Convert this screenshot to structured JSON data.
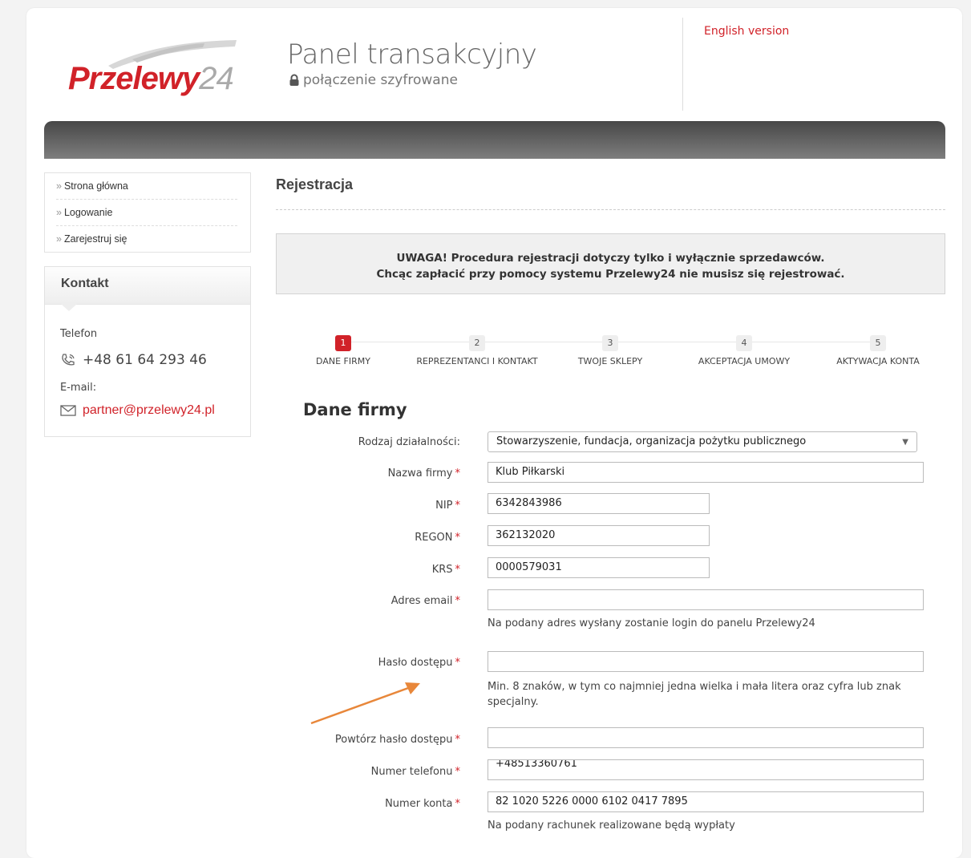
{
  "header": {
    "logo_main": "Przelewy",
    "logo_num": "24",
    "title": "Panel transakcyjny",
    "subtitle": "połączenie szyfrowane",
    "english_link": "English version"
  },
  "sidebar": {
    "nav": [
      {
        "label": "Strona główna"
      },
      {
        "label": "Logowanie"
      },
      {
        "label": "Zarejestruj się"
      }
    ],
    "contact": {
      "title": "Kontakt",
      "phone_label": "Telefon",
      "phone": "+48 61 64 293 46",
      "email_label": "E-mail:",
      "email": "partner@przelewy24.pl"
    }
  },
  "main": {
    "title": "Rejestracja",
    "notice_line1": "UWAGA! Procedura rejestracji dotyczy tylko i wyłącznie sprzedawców.",
    "notice_line2": "Chcąc zapłacić przy pomocy systemu Przelewy24 nie musisz się rejestrować.",
    "steps": [
      {
        "num": "1",
        "label": "DANE FIRMY",
        "active": true
      },
      {
        "num": "2",
        "label": "REPREZENTANCI I KONTAKT",
        "active": false
      },
      {
        "num": "3",
        "label": "TWOJE SKLEPY",
        "active": false
      },
      {
        "num": "4",
        "label": "AKCEPTACJA UMOWY",
        "active": false
      },
      {
        "num": "5",
        "label": "AKTYWACJA KONTA",
        "active": false
      }
    ],
    "form_title": "Dane firmy",
    "fields": {
      "activity_type": {
        "label": "Rodzaj działalności:",
        "value": "Stowarzyszenie, fundacja, organizacja pożytku publicznego"
      },
      "company_name": {
        "label": "Nazwa firmy",
        "value": "Klub Piłkarski"
      },
      "nip": {
        "label": "NIP",
        "value": "6342843986"
      },
      "regon": {
        "label": "REGON",
        "value": "362132020"
      },
      "krs": {
        "label": "KRS",
        "value": "0000579031"
      },
      "email": {
        "label": "Adres email",
        "value": "",
        "hint": "Na podany adres wysłany zostanie login do panelu Przelewy24"
      },
      "password": {
        "label": "Hasło dostępu",
        "value": "",
        "hint": "Min. 8 znaków, w tym co najmniej jedna wielka i mała litera oraz cyfra lub znak specjalny."
      },
      "password_repeat": {
        "label": "Powtórz hasło dostępu",
        "value": ""
      },
      "phone": {
        "label": "Numer telefonu",
        "value": "+48513360761"
      },
      "account": {
        "label": "Numer konta",
        "value": "82 1020 5226 0000 6102 0417 7895",
        "hint": "Na podany rachunek realizowane będą wypłaty"
      }
    },
    "required_mark": "*"
  },
  "colors": {
    "brand": "#d12229",
    "annotation_arrow": "#e8873a"
  }
}
